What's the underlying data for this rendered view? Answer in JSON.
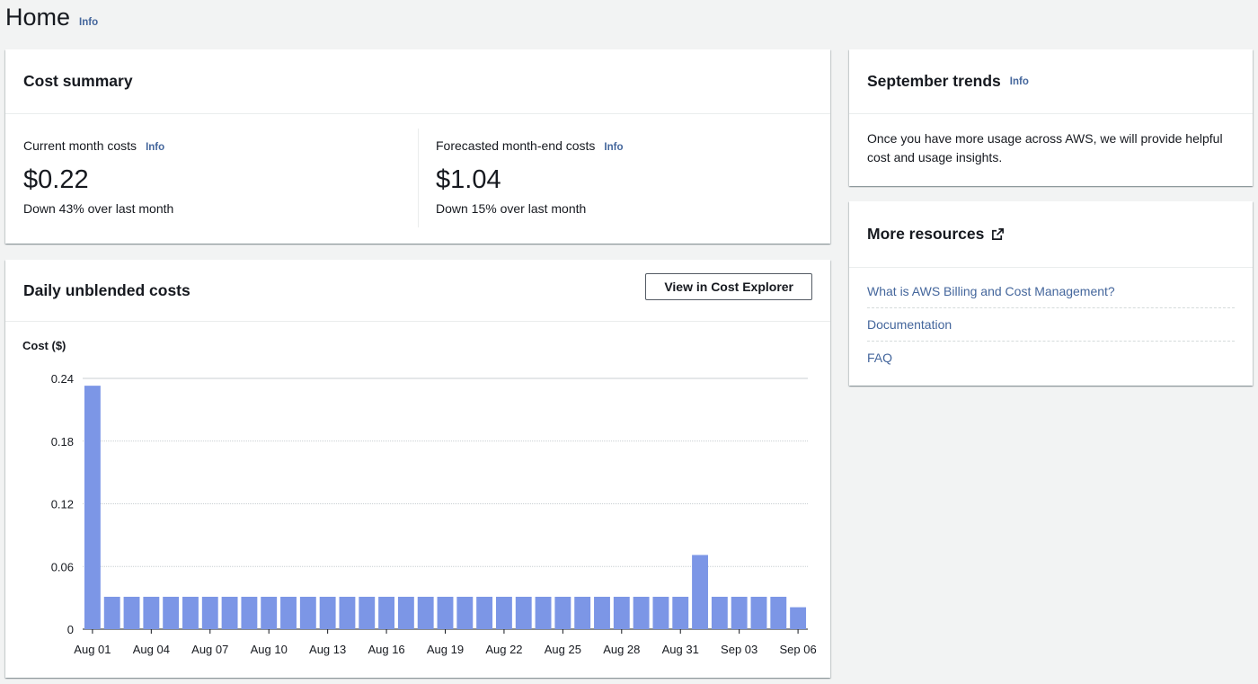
{
  "page": {
    "title": "Home",
    "info": "Info"
  },
  "cost_summary": {
    "title": "Cost summary",
    "current": {
      "label": "Current month costs",
      "info": "Info",
      "value": "$0.22",
      "sub": "Down 43% over last month"
    },
    "forecast": {
      "label": "Forecasted month-end costs",
      "info": "Info",
      "value": "$1.04",
      "sub": "Down 15% over last month"
    }
  },
  "daily": {
    "title": "Daily unblended costs",
    "button": "View in Cost Explorer"
  },
  "chart_data": {
    "type": "bar",
    "ylabel": "Cost ($)",
    "ylim": [
      0,
      0.24
    ],
    "yticks": [
      "0",
      "0.06",
      "0.12",
      "0.18",
      "0.24"
    ],
    "ytick_values": [
      0,
      0.06,
      0.12,
      0.18,
      0.24
    ],
    "grid": true,
    "color": "#7c96e6",
    "categories": [
      "Aug 01",
      "Aug 02",
      "Aug 03",
      "Aug 04",
      "Aug 05",
      "Aug 06",
      "Aug 07",
      "Aug 08",
      "Aug 09",
      "Aug 10",
      "Aug 11",
      "Aug 12",
      "Aug 13",
      "Aug 14",
      "Aug 15",
      "Aug 16",
      "Aug 17",
      "Aug 18",
      "Aug 19",
      "Aug 20",
      "Aug 21",
      "Aug 22",
      "Aug 23",
      "Aug 24",
      "Aug 25",
      "Aug 26",
      "Aug 27",
      "Aug 28",
      "Aug 29",
      "Aug 30",
      "Aug 31",
      "Sep 01",
      "Sep 02",
      "Sep 03",
      "Sep 04",
      "Sep 05",
      "Sep 06"
    ],
    "values": [
      0.233,
      0.031,
      0.031,
      0.031,
      0.031,
      0.031,
      0.031,
      0.031,
      0.031,
      0.031,
      0.031,
      0.031,
      0.031,
      0.031,
      0.031,
      0.031,
      0.031,
      0.031,
      0.031,
      0.031,
      0.031,
      0.031,
      0.031,
      0.031,
      0.031,
      0.031,
      0.031,
      0.031,
      0.031,
      0.031,
      0.031,
      0.071,
      0.031,
      0.031,
      0.031,
      0.031,
      0.021
    ],
    "xtick_labels": [
      "Aug 01",
      "Aug 04",
      "Aug 07",
      "Aug 10",
      "Aug 13",
      "Aug 16",
      "Aug 19",
      "Aug 22",
      "Aug 25",
      "Aug 28",
      "Aug 31",
      "Sep 03",
      "Sep 06"
    ]
  },
  "trends": {
    "title": "September trends",
    "info": "Info",
    "body": "Once you have more usage across AWS, we will provide helpful cost and usage insights."
  },
  "resources": {
    "title": "More resources",
    "icon": "external-link-icon",
    "items": [
      "What is AWS Billing and Cost Management?",
      "Documentation",
      "FAQ"
    ]
  }
}
